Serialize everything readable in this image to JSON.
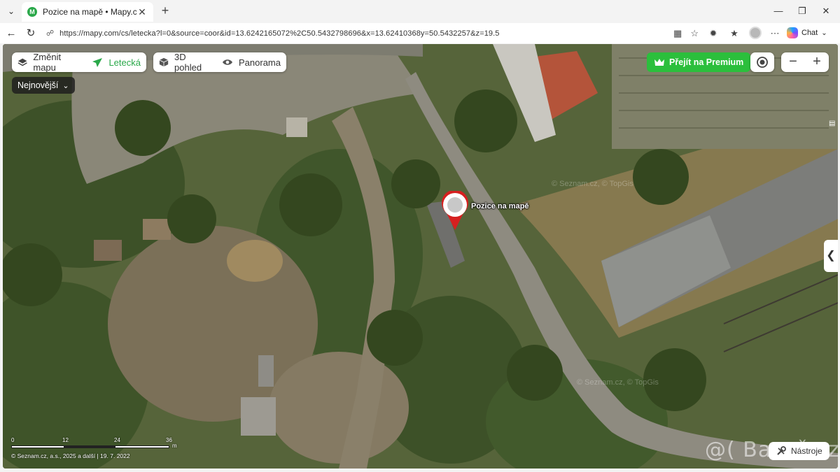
{
  "browser": {
    "tab_title": "Pozice na mapě • Mapy.com",
    "favicon_letter": "M",
    "url": "https://mapy.com/cs/letecka?l=0&source=coor&id=13.6242165072%2C50.5432798696&x=13.62410368y=50.5432257&z=19.5",
    "chat_label": "Chat",
    "icons": [
      "tab-list-icon",
      "close-icon",
      "new-tab-icon",
      "minimize-icon",
      "maximize-icon",
      "window-close-icon",
      "back-icon",
      "reload-icon",
      "site-info-icon",
      "app-available-icon",
      "favorite-icon",
      "extensions-icon",
      "favorites-list-icon",
      "more-icon",
      "copilot-icon"
    ]
  },
  "map": {
    "layer_switch": {
      "change_label": "Změnit mapu",
      "active_label": "Letecká"
    },
    "view_modes": {
      "three_d_label": "3D pohled",
      "panorama_label": "Panorama"
    },
    "imagery_select": {
      "value": "Nejnovější"
    },
    "premium_label": "Přejít na Premium",
    "pin_label": "Pozice na mapě",
    "watermark": "© Seznam.cz, © TopGis",
    "scale": {
      "ticks": [
        "0",
        "12",
        "24",
        "36"
      ],
      "unit": "m"
    },
    "copyright": "© Seznam.cz, a.s., 2025 a další | 19. 7. 2022",
    "tools_label": "Nástroje"
  },
  "overlay": {
    "bazos_watermark": "@( Bazoš.cz"
  },
  "colors": {
    "accent_green": "#2bbf3c",
    "pin_red": "#d62020"
  }
}
